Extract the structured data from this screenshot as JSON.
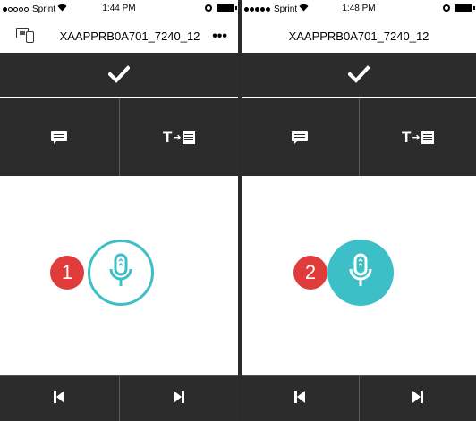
{
  "screens": [
    {
      "status": {
        "carrier": "Sprint",
        "time": "1:44 PM",
        "signal_filled": 1
      },
      "nav": {
        "title": "XAAPPRB0A701_7240_12",
        "more": "•••",
        "show_device_icon": true
      },
      "step": {
        "number": "1"
      },
      "mic": {
        "state": "outlined"
      }
    },
    {
      "status": {
        "carrier": "Sprint",
        "time": "1:48 PM",
        "signal_filled": 5
      },
      "nav": {
        "title": "XAAPPRB0A701_7240_12",
        "show_device_icon": false
      },
      "step": {
        "number": "2"
      },
      "mic": {
        "state": "filled"
      }
    }
  ],
  "toolbar": {
    "confirm_icon": "checkmark-icon",
    "comment_icon": "comment-icon",
    "text_to_document_icon": "text-to-document-icon",
    "previous_icon": "skip-previous-icon",
    "next_icon": "skip-next-icon"
  },
  "colors": {
    "toolbar_bg": "#2c2c2c",
    "accent_teal": "#3cbfc6",
    "badge_red": "#e03c3c"
  }
}
